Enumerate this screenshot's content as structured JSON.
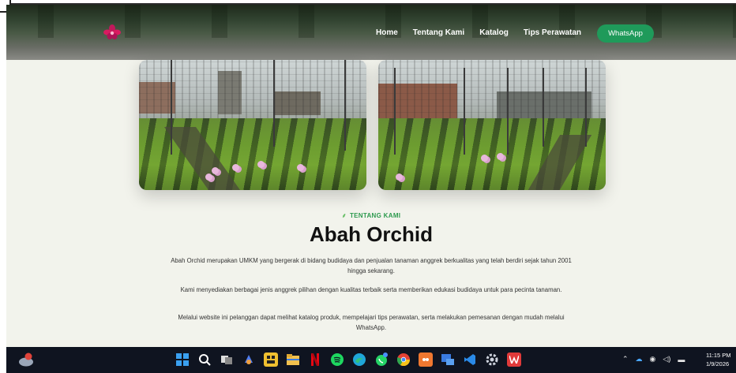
{
  "nav": {
    "links": [
      "Home",
      "Tentang Kami",
      "Katalog",
      "Tips Perawatan"
    ],
    "whatsapp_label": "WhatsApp"
  },
  "about": {
    "tag": "TENTANG KAMI",
    "title": "Abah Orchid",
    "paragraphs": [
      "Abah Orchid merupakan UMKM yang bergerak di bidang budidaya dan penjualan tanaman anggrek berkualitas yang telah berdiri sejak tahun 2001 hingga sekarang.",
      "Kami menyediakan berbagai jenis anggrek pilihan dengan kualitas terbaik serta memberikan edukasi budidaya untuk para pecinta tanaman.",
      "Melalui website ini pelanggan dapat melihat katalog produk, mempelajari tips perawatan, serta melakukan pemesanan dengan mudah melalui WhatsApp."
    ]
  },
  "colors": {
    "accent_green": "#2d9a4e",
    "whatsapp_button": "#1f9a5a",
    "page_background": "#f2f3ec",
    "taskbar": "#0f1420"
  },
  "taskbar": {
    "icons": [
      "windows-start-icon",
      "search-icon",
      "task-view-icon",
      "copilot-icon",
      "widgets-icon",
      "file-explorer-icon",
      "netflix-icon",
      "spotify-icon",
      "edge-icon",
      "whatsapp-icon",
      "chrome-icon",
      "app-orange-icon",
      "app-blue-icon",
      "vscode-icon",
      "settings-icon",
      "wps-icon"
    ],
    "time": "11:15 PM",
    "date": "1/9/2026"
  }
}
